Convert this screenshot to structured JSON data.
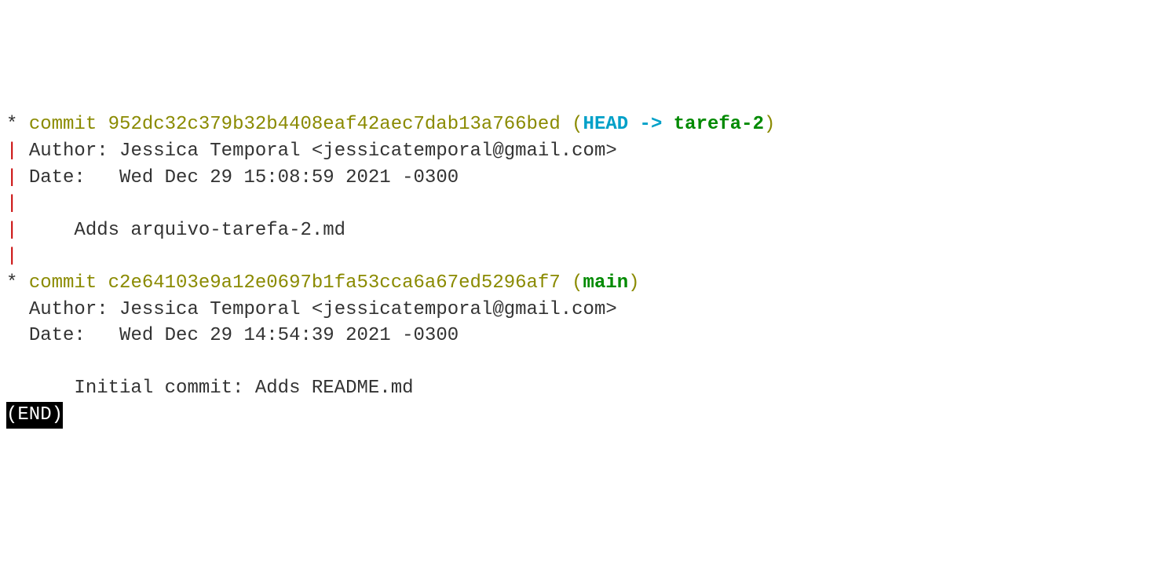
{
  "log": {
    "commits": [
      {
        "graph_star": "*",
        "commit_word": "commit",
        "hash": "952dc32c379b32b4408eaf42aec7dab13a766bed",
        "refs_open": "(",
        "head": "HEAD -> ",
        "branch": "tarefa-2",
        "refs_close": ")",
        "graph_pipe": "|",
        "author_label": "Author:",
        "author_value": "Jessica Temporal <jessicatemporal@gmail.com>",
        "date_label": "Date:",
        "date_value": "Wed Dec 29 15:08:59 2021 -0300",
        "message": "Adds arquivo-tarefa-2.md"
      },
      {
        "graph_star": "*",
        "commit_word": "commit",
        "hash": "c2e64103e9a12e0697b1fa53cca6a67ed5296af7",
        "refs_open": "(",
        "branch": "main",
        "refs_close": ")",
        "author_label": "Author:",
        "author_value": "Jessica Temporal <jessicatemporal@gmail.com>",
        "date_label": "Date:",
        "date_value": "Wed Dec 29 14:54:39 2021 -0300",
        "message": "Initial commit: Adds README.md"
      }
    ],
    "end_marker": "(END)"
  }
}
